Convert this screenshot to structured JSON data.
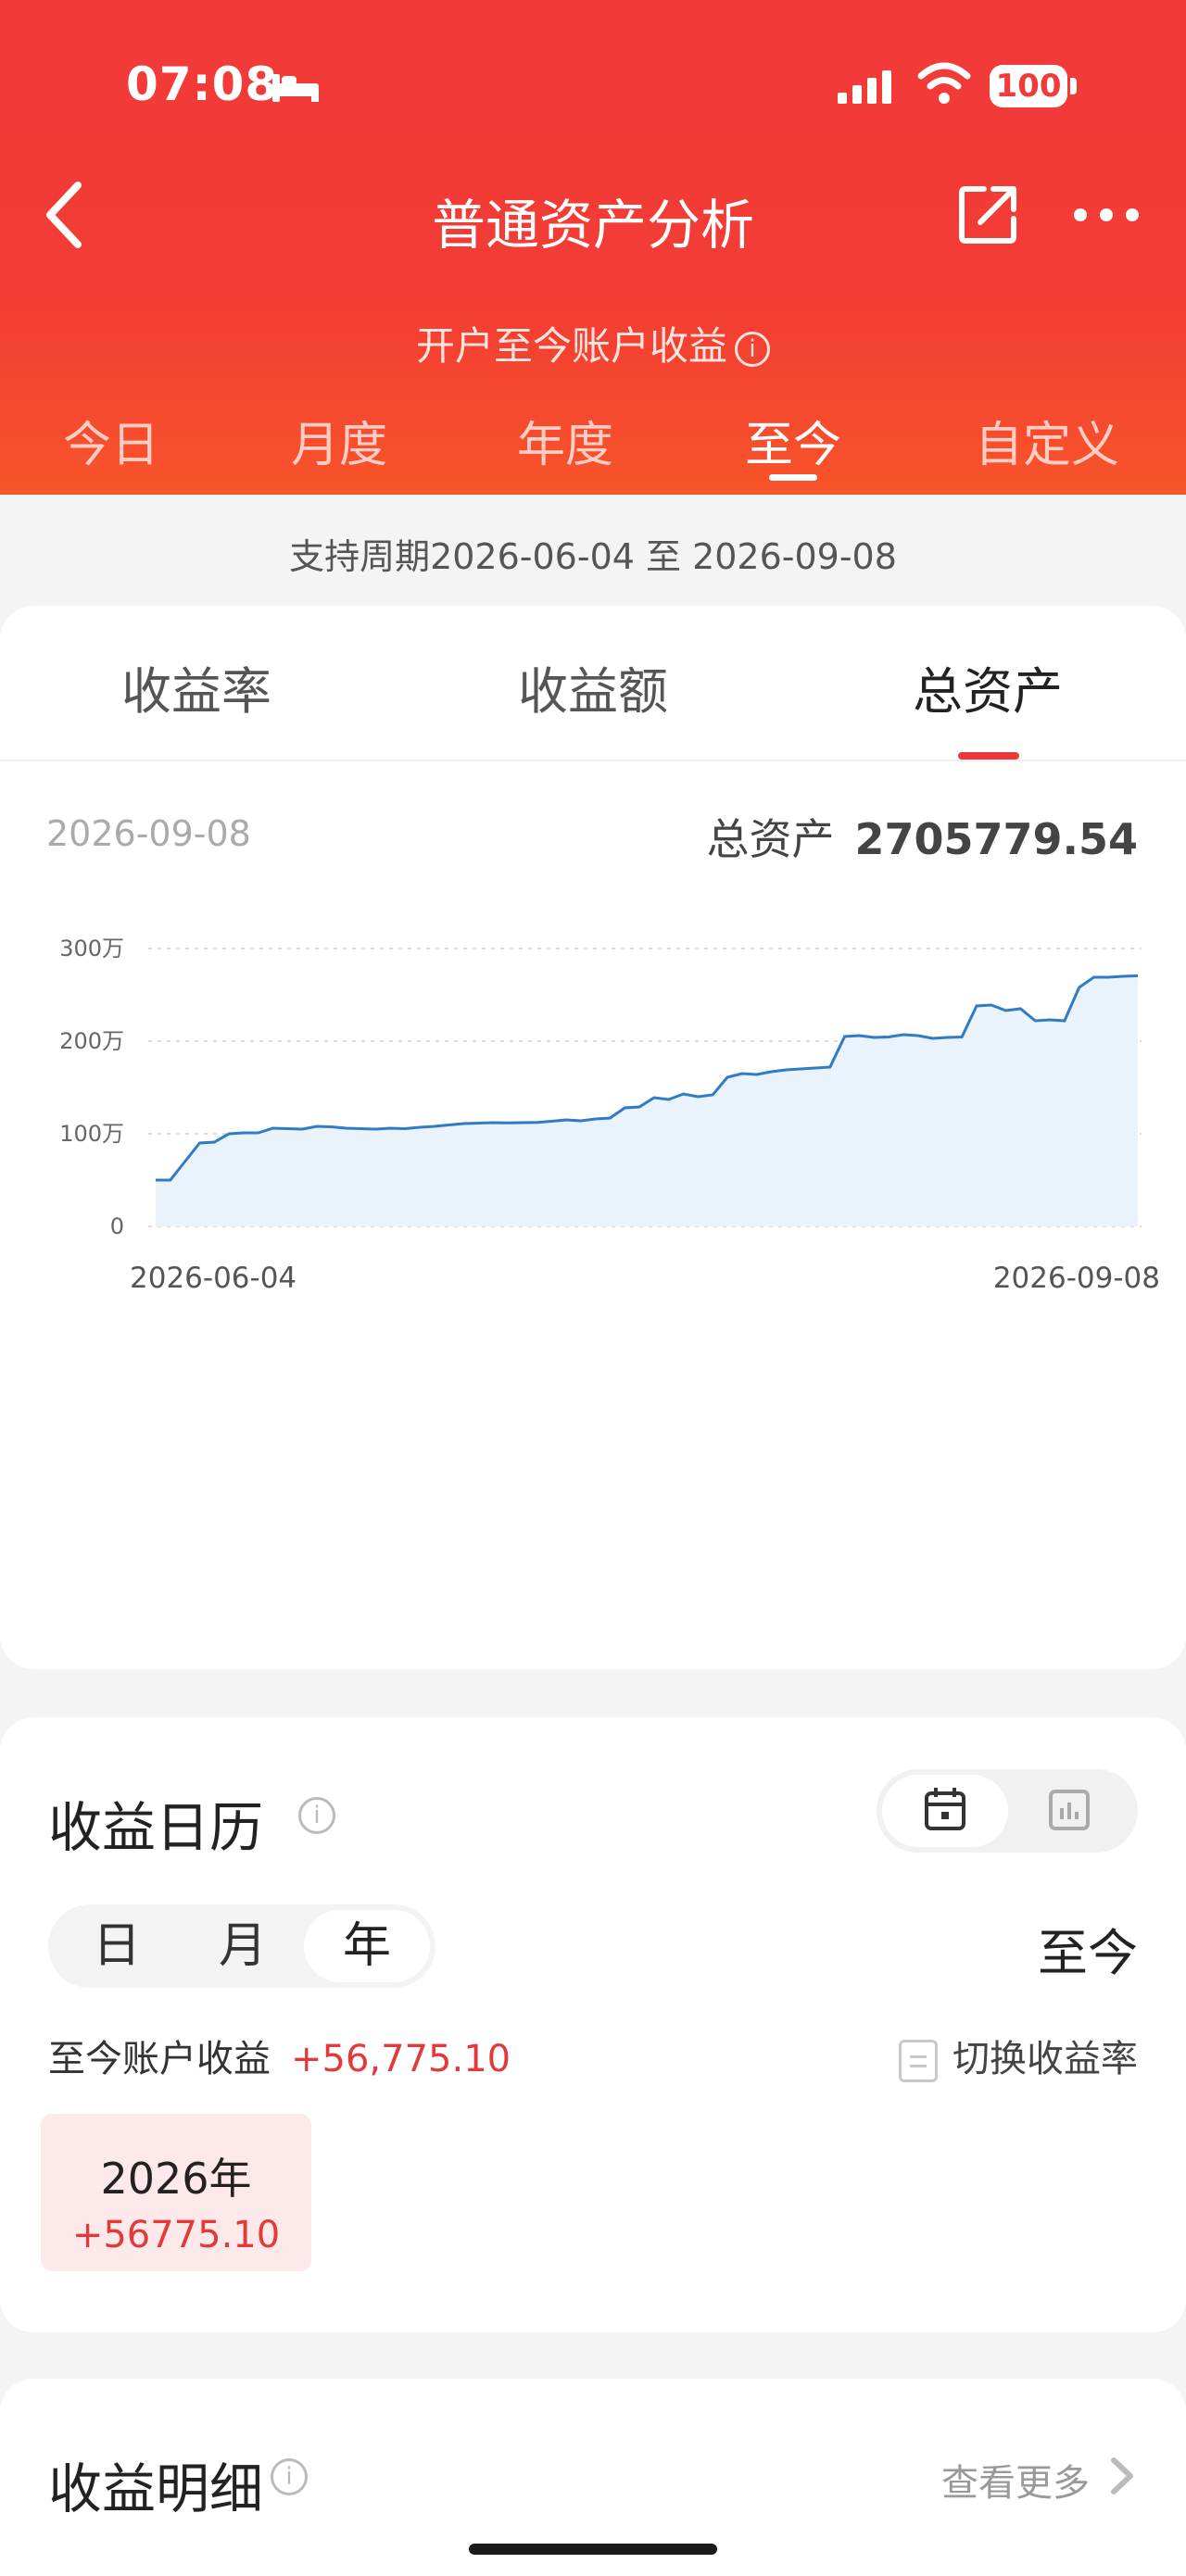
{
  "status": {
    "time": "07:08",
    "battery": "100"
  },
  "header": {
    "title": "普通资产分析",
    "subtitle": "开户至今账户收益",
    "info_symbol": "i",
    "period_tabs": [
      "今日",
      "月度",
      "年度",
      "至今",
      "自定义"
    ],
    "active_period": "至今"
  },
  "range_text": "支持周期2026-06-04 至 2026-09-08",
  "metric_tabs": [
    "收益率",
    "收益额",
    "总资产"
  ],
  "active_metric": "总资产",
  "selected": {
    "date": "2026-09-08",
    "label": "总资产",
    "value": "2705779.54"
  },
  "chart_data": {
    "type": "area",
    "x_start": "2026-06-04",
    "x_end": "2026-09-08",
    "yticks": [
      "300万",
      "200万",
      "100万",
      "0"
    ],
    "ylim": [
      0,
      3000000
    ],
    "ylabel": "",
    "xlabel": "",
    "values": [
      500000,
      500000,
      700000,
      900000,
      910000,
      1000000,
      1010000,
      1010000,
      1060000,
      1055000,
      1050000,
      1080000,
      1075000,
      1060000,
      1055000,
      1050000,
      1060000,
      1055000,
      1070000,
      1080000,
      1095000,
      1110000,
      1115000,
      1120000,
      1118000,
      1120000,
      1122000,
      1135000,
      1150000,
      1140000,
      1160000,
      1170000,
      1280000,
      1290000,
      1390000,
      1370000,
      1430000,
      1400000,
      1420000,
      1610000,
      1650000,
      1640000,
      1670000,
      1690000,
      1700000,
      1710000,
      1720000,
      2050000,
      2060000,
      2040000,
      2045000,
      2070000,
      2060000,
      2030000,
      2040000,
      2045000,
      2380000,
      2390000,
      2330000,
      2350000,
      2220000,
      2230000,
      2220000,
      2580000,
      2690000,
      2690000,
      2700000,
      2705779.54
    ],
    "line_color": "#2f7cc4",
    "fill_color": "#eaf2fc",
    "grid": true
  },
  "calendar": {
    "title": "收益日历",
    "info_symbol": "i",
    "granularity": [
      "日",
      "月",
      "年"
    ],
    "active_granularity": "年",
    "period_label": "至今",
    "account_label": "至今账户收益",
    "account_value": "+56,775.10",
    "switch_label": "切换收益率",
    "cells": [
      {
        "year": "2026年",
        "value": "+56775.10"
      }
    ]
  },
  "detail": {
    "title": "收益明细",
    "info_symbol": "i",
    "more": "查看更多"
  },
  "colors": {
    "brand_red": "#f23a3a",
    "positive": "#e23a3a"
  }
}
